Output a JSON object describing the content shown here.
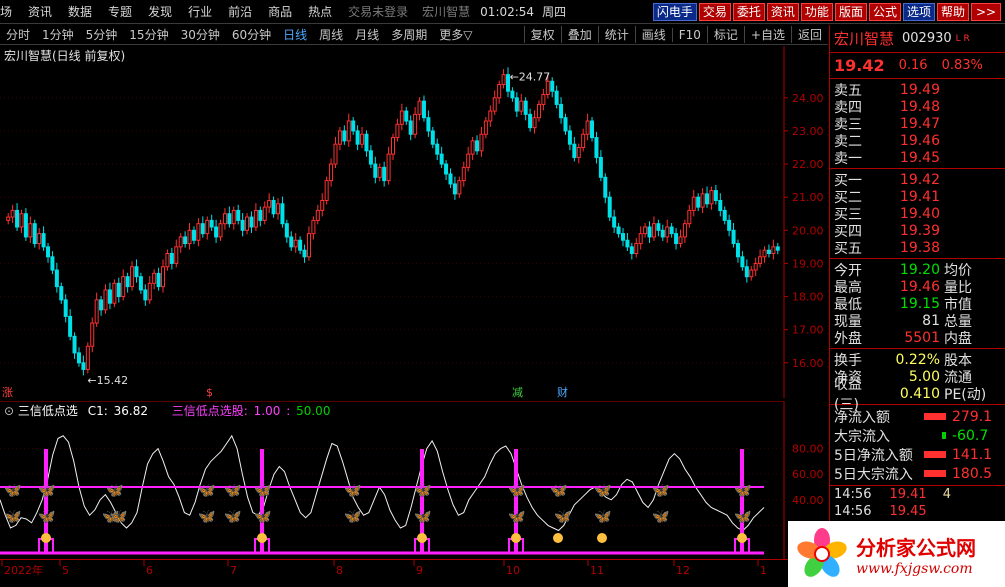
{
  "menu": {
    "items": [
      "场",
      "资讯",
      "数据",
      "专题",
      "发现",
      "行业",
      "前沿",
      "商品",
      "热点"
    ],
    "login": "交易未登录",
    "window_title": "宏川智慧",
    "clock": "01:02:54",
    "weekday": "周四",
    "quick": [
      "闪电手",
      "交易",
      "委托",
      "资讯",
      "功能",
      "版面",
      "公式",
      "选项",
      "帮助",
      ">>"
    ]
  },
  "periods": {
    "items": [
      "分时",
      "1分钟",
      "5分钟",
      "15分钟",
      "30分钟",
      "60分钟",
      "日线",
      "周线",
      "月线",
      "多周期",
      "更多▽"
    ],
    "active": "日线",
    "tools": [
      "复权",
      "叠加",
      "统计",
      "画线",
      "F10",
      "标记",
      "+自选",
      "返回"
    ]
  },
  "chart_header": {
    "title": "宏川智慧(日线 前复权)"
  },
  "chart_data": [
    {
      "type": "candlestick",
      "title": "宏川智慧(日线 前复权)",
      "ylim": [
        15.3,
        24.9
      ],
      "yticks": [
        "24.00",
        "23.00",
        "22.00",
        "21.00",
        "20.00",
        "19.00",
        "18.00",
        "17.00",
        "16.00"
      ],
      "annotations": {
        "high": "24.77",
        "low": "15.42"
      },
      "markers": [
        "涨",
        "$",
        "减",
        "财"
      ],
      "closes": [
        20.4,
        20.6,
        20.1,
        20.5,
        19.8,
        20.2,
        19.6,
        19.9,
        19.5,
        19.2,
        18.8,
        18.3,
        17.9,
        17.4,
        16.8,
        16.3,
        16.0,
        15.8,
        16.5,
        17.2,
        17.9,
        17.6,
        18.2,
        17.8,
        18.4,
        18.0,
        18.6,
        18.3,
        18.9,
        18.6,
        18.2,
        17.9,
        18.4,
        18.7,
        18.3,
        18.9,
        19.3,
        19.0,
        19.5,
        19.8,
        19.6,
        20.0,
        19.7,
        20.2,
        19.9,
        20.3,
        20.1,
        19.8,
        20.2,
        20.5,
        20.2,
        20.6,
        20.3,
        20.0,
        20.4,
        20.1,
        20.6,
        20.3,
        20.7,
        20.9,
        20.5,
        20.8,
        20.2,
        19.8,
        19.5,
        19.7,
        19.4,
        19.2,
        19.9,
        20.3,
        20.6,
        20.9,
        21.5,
        22.0,
        22.6,
        23.0,
        22.7,
        23.3,
        23.0,
        22.6,
        22.9,
        22.4,
        22.0,
        21.6,
        21.9,
        21.5,
        22.3,
        22.8,
        23.2,
        23.6,
        23.3,
        22.9,
        23.5,
        23.9,
        23.4,
        23.0,
        22.6,
        22.3,
        22.0,
        21.7,
        21.4,
        21.1,
        21.5,
        21.9,
        22.3,
        22.7,
        22.4,
        22.9,
        23.3,
        23.6,
        24.0,
        24.4,
        24.7,
        24.2,
        24.0,
        23.6,
        23.9,
        23.5,
        23.1,
        23.4,
        23.8,
        24.1,
        24.5,
        24.2,
        23.8,
        23.4,
        23.0,
        22.6,
        22.2,
        22.5,
        22.9,
        23.3,
        22.8,
        22.2,
        21.6,
        21.0,
        20.4,
        20.1,
        19.9,
        19.7,
        19.5,
        19.3,
        19.6,
        19.9,
        20.1,
        19.8,
        20.2,
        20.0,
        19.8,
        20.1,
        19.9,
        19.6,
        19.8,
        20.2,
        20.6,
        21.0,
        20.7,
        21.1,
        20.8,
        21.2,
        20.9,
        20.6,
        20.3,
        20.0,
        19.6,
        19.2,
        18.9,
        18.6,
        18.8,
        19.0,
        19.2,
        19.4,
        19.3,
        19.5,
        19.4
      ]
    },
    {
      "type": "line",
      "title": "三信低点选",
      "ylim": [
        0,
        100
      ],
      "yticks": [
        "80.00",
        "60.00",
        "40.00",
        "20.00"
      ],
      "series": [
        {
          "name": "C1",
          "value": "36.82"
        },
        {
          "name": "三信低点选股",
          "values": [
            "1.00",
            "50.00"
          ]
        }
      ],
      "line": [
        40,
        28,
        18,
        20,
        26,
        25,
        22,
        30,
        40,
        55,
        75,
        88,
        90,
        85,
        70,
        50,
        35,
        28,
        32,
        40,
        44,
        38,
        30,
        22,
        18,
        22,
        30,
        50,
        68,
        76,
        80,
        70,
        58,
        52,
        42,
        30,
        28,
        38,
        52,
        64,
        70,
        74,
        78,
        84,
        90,
        80,
        60,
        42,
        30,
        28,
        34,
        48,
        60,
        66,
        62,
        50,
        40,
        30,
        26,
        30,
        44,
        58,
        72,
        84,
        82,
        70,
        56,
        42,
        34,
        28,
        30,
        40,
        50,
        44,
        32,
        24,
        18,
        20,
        34,
        50,
        66,
        80,
        86,
        78,
        62,
        48,
        36,
        28,
        30,
        40,
        46,
        52,
        58,
        68,
        76,
        80,
        82,
        76,
        64,
        52,
        42,
        34,
        28,
        24,
        20,
        18,
        16,
        20,
        28,
        36,
        40,
        44,
        48,
        50,
        46,
        42,
        40,
        44,
        52,
        56,
        54,
        46,
        38,
        34,
        40,
        52,
        62,
        72,
        76,
        72,
        64,
        58,
        50,
        44,
        38,
        34,
        32,
        30,
        28,
        22,
        18,
        16,
        20,
        26,
        30,
        34
      ]
    }
  ],
  "sub_header": {
    "title": "三信低点选",
    "c1_label": "C1:",
    "c1_value": "36.82",
    "signal_label": "三信低点选股:",
    "signal_v1": "1.00",
    "signal_v2": "50.00"
  },
  "date_axis": [
    "2022年",
    "5",
    "6",
    "7",
    "8",
    "9",
    "10",
    "11",
    "12",
    "1"
  ],
  "quote": {
    "name": "宏川智慧",
    "code": "002930",
    "flag": "L R",
    "price": "19.42",
    "change": "0.16",
    "rate": "0.83%",
    "asks": [
      {
        "label": "卖五",
        "price": "19.49"
      },
      {
        "label": "卖四",
        "price": "19.48"
      },
      {
        "label": "卖三",
        "price": "19.47"
      },
      {
        "label": "卖二",
        "price": "19.46"
      },
      {
        "label": "卖一",
        "price": "19.45"
      }
    ],
    "bids": [
      {
        "label": "买一",
        "price": "19.42"
      },
      {
        "label": "买二",
        "price": "19.41"
      },
      {
        "label": "买三",
        "price": "19.40"
      },
      {
        "label": "买四",
        "price": "19.39"
      },
      {
        "label": "买五",
        "price": "19.38"
      }
    ],
    "stats": [
      {
        "label": "今开",
        "value": "19.20",
        "cls": "g",
        "label2": "均价"
      },
      {
        "label": "最高",
        "value": "19.46",
        "cls": "",
        "label2": "量比"
      },
      {
        "label": "最低",
        "value": "19.15",
        "cls": "g",
        "label2": "市值"
      },
      {
        "label": "现量",
        "value": "81",
        "cls": "y",
        "label2": "总量"
      },
      {
        "label": "外盘",
        "value": "5501",
        "cls": "",
        "label2": "内盘"
      }
    ],
    "fin": [
      {
        "label": "换手",
        "value": "0.22%",
        "label2": "股本"
      },
      {
        "label": "净资",
        "value": "5.00",
        "label2": "流通"
      },
      {
        "label": "收益(三)",
        "value": "0.410",
        "label2": "PE(动)"
      }
    ],
    "flows": [
      {
        "label": "净流入额",
        "value": "279.1",
        "neg": false
      },
      {
        "label": "大宗流入",
        "value": "-60.7",
        "neg": true
      },
      {
        "label": "5日净流入额",
        "value": "141.1",
        "neg": false
      },
      {
        "label": "5日大宗流入",
        "value": "180.5",
        "neg": false
      }
    ],
    "ticks": [
      {
        "time": "14:56",
        "price": "19.41",
        "vol": "4"
      },
      {
        "time": "14:56",
        "price": "19.45",
        "vol": ""
      }
    ]
  },
  "watermark": {
    "title": "分析家公式网",
    "url": "www.fxjgsw.com"
  },
  "colors": {
    "up": "#ff3030",
    "down": "#00e0e8",
    "axis": "#b00000",
    "signal": "#ff20ff"
  }
}
